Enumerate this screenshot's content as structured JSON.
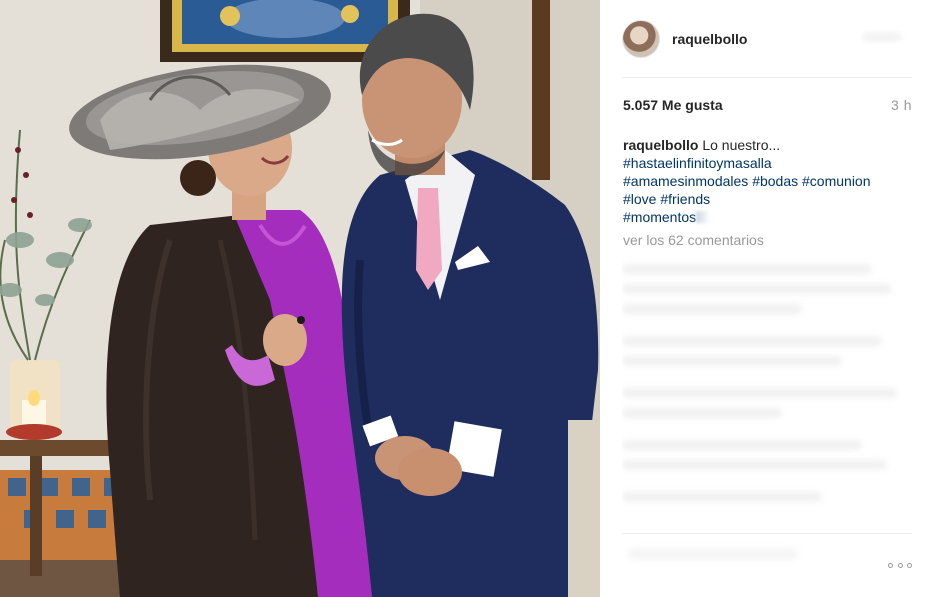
{
  "post": {
    "username": "raquelbollo",
    "likes": "5.057 Me gusta",
    "time_ago": "3 h",
    "caption_user": "raquelbollo",
    "caption_text": "Lo nuestro...",
    "hashtags_line1": "#hastaelinfinitoymasalla",
    "hashtags_line2a": "#amamesinmodales",
    "hashtags_line2b": "#bodas",
    "hashtags_line2c": "#comunion",
    "hashtags_line3a": "#love",
    "hashtags_line3b": "#friends",
    "hashtags_line4": "#momentos",
    "view_comments": "ver los 62 comentarios"
  },
  "icons": {
    "avatar": "profile-photo",
    "more": "more-options-dots-icon"
  },
  "colors": {
    "hashtag": "#003569",
    "muted": "#999999",
    "text": "#262626",
    "divider": "#efefef"
  }
}
